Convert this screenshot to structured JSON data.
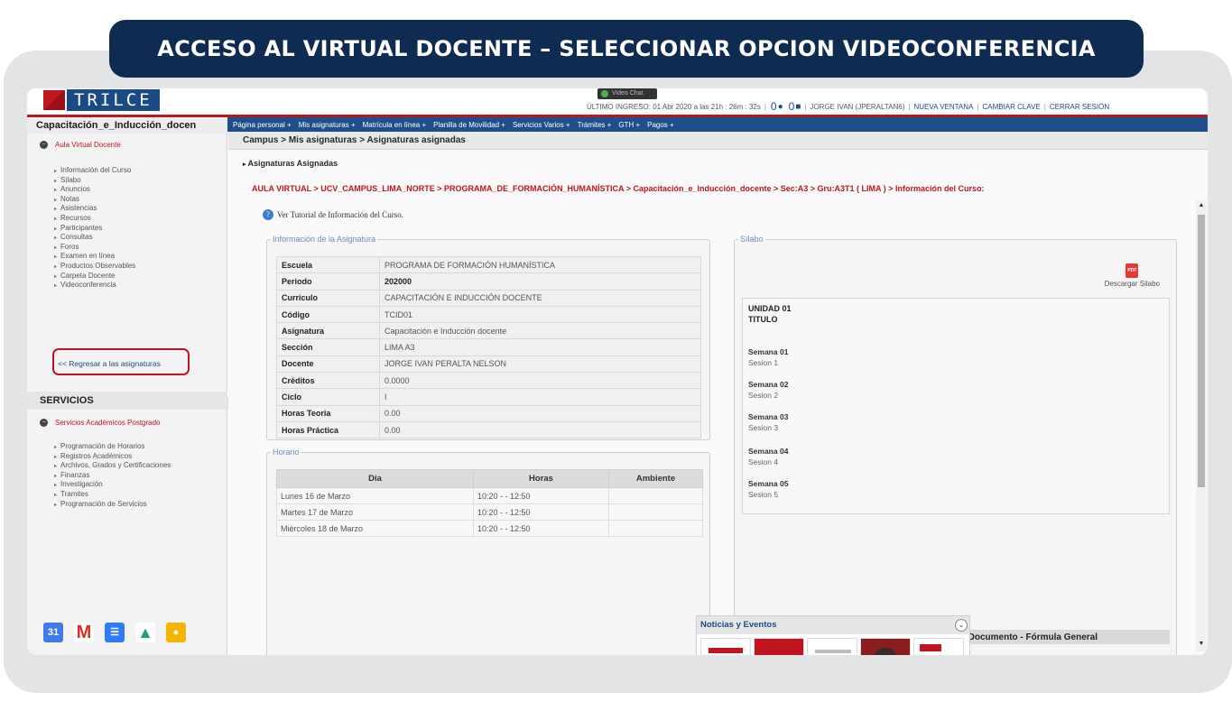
{
  "banner": {
    "title": "ACCESO AL VIRTUAL DOCENTE – SELECCIONAR OPCION VIDEOCONFERENCIA"
  },
  "header": {
    "logo_text": "TRILCE",
    "live_button": "Video Chat",
    "last_login": "ÚLTIMO INGRESO: 01 Abr 2020 a las 21h : 26m : 32s",
    "count1": "0",
    "count2": "0",
    "user": "JORGE IVAN (JPERALTAN6)",
    "links": [
      "NUEVA VENTANA",
      "CAMBIAR CLAVE",
      "CERRAR SESIÓN"
    ]
  },
  "sidebar": {
    "course": "Capacitación_e_Inducción_docen",
    "section1": "Aula Virtual Docente",
    "items": [
      "Información del Curso",
      "Sílabo",
      "Anuncios",
      "Notas",
      "Asistencias",
      "Recursos",
      "Participantes",
      "Consultas",
      "Foros",
      "Examen en línea",
      "Productos Observables",
      "Carpeta Docente",
      "Videoconferencia"
    ],
    "back": "<< Regresar a las asignaturas",
    "servicios": "SERVICIOS",
    "section2": "Servicios Académicos Postgrado",
    "items2": [
      "Programación de Horarios",
      "Registros Académicos",
      "Archivos, Grados y Certificaciones",
      "Finanzas",
      "Investigación",
      "Tramites",
      "Programación de Servicios"
    ]
  },
  "navbar": [
    "Página personal +",
    "Mis asignaturas +",
    "Matrícula en línea +",
    "Planilla de Movilidad +",
    "Servicios Varios +",
    "Trámites +",
    "GTH +",
    "Pagos +"
  ],
  "main": {
    "breadcrumb": "Campus > Mis asignaturas > Asignaturas asignadas",
    "subtitle": "Asignaturas Asignadas",
    "path": "AULA VIRTUAL > UCV_CAMPUS_LIMA_NORTE > PROGRAMA_DE_FORMACIÓN_HUMANÍSTICA > Capacitación_e_Inducción_docente > Sec:A3 > Gru:A3T1 ( LIMA ) > Información del Curso:",
    "tutorial": "Ver Tutorial de Información del Curso."
  },
  "info": {
    "legend": "Información de la Asignatura",
    "rows": [
      {
        "k": "Escuela",
        "v": "PROGRAMA DE FORMACIÓN HUMANÍSTICA"
      },
      {
        "k": "Periodo",
        "v": "202000"
      },
      {
        "k": "Curriculo",
        "v": "CAPACITACIÓN E INDUCCIÓN DOCENTE"
      },
      {
        "k": "Código",
        "v": "TCID01"
      },
      {
        "k": "Asignatura",
        "v": "Capacitación e Inducción docente"
      },
      {
        "k": "Sección",
        "v": "LIMA A3"
      },
      {
        "k": "Docente",
        "v": "JORGE IVAN PERALTA NELSON"
      },
      {
        "k": "Créditos",
        "v": "0.0000"
      },
      {
        "k": "Ciclo",
        "v": "I"
      },
      {
        "k": "Horas Teoria",
        "v": "0.00"
      },
      {
        "k": "Horas Práctica",
        "v": "0.00"
      }
    ]
  },
  "horario": {
    "legend": "Horario",
    "headers": [
      "Dia",
      "Horas",
      "Ambiente"
    ],
    "rows": [
      [
        "Lunes 16 de Marzo",
        "10:20 - - 12:50",
        ""
      ],
      [
        "Martes 17 de Marzo",
        "10:20 - - 12:50",
        ""
      ],
      [
        "Miércoles 18 de Marzo",
        "10:20 - - 12:50",
        ""
      ]
    ]
  },
  "silabo": {
    "legend": "Sílabo",
    "download": "Descargar Silabo",
    "unit": "UNIDAD 01",
    "unit_title": "TITULO",
    "weeks": [
      {
        "w": "Semana 01",
        "s": "Sesion 1"
      },
      {
        "w": "Semana 02",
        "s": "Sesion 2"
      },
      {
        "w": "Semana 03",
        "s": "Sesion 3"
      },
      {
        "w": "Semana 04",
        "s": "Sesion 4"
      },
      {
        "w": "Semana 05",
        "s": "Sesion 5"
      }
    ],
    "doc_bar": "Documento - Fórmula General"
  },
  "news": {
    "title": "Noticias y Eventos"
  },
  "colors": {
    "banner": "#0f2b52",
    "nav": "#1f4f8a",
    "accent": "#c0141e"
  }
}
